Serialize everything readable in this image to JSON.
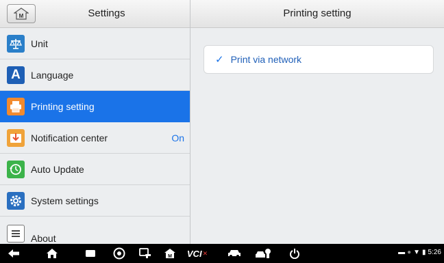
{
  "left_header": {
    "title": "Settings"
  },
  "right_header": {
    "title": "Printing setting"
  },
  "sidebar": {
    "items": [
      {
        "label": "Unit",
        "icon": "scale-icon",
        "value": ""
      },
      {
        "label": "Language",
        "icon": "language-icon",
        "value": ""
      },
      {
        "label": "Printing setting",
        "icon": "printer-icon",
        "value": "",
        "active": true
      },
      {
        "label": "Notification center",
        "icon": "notification-icon",
        "value": "On"
      },
      {
        "label": "Auto Update",
        "icon": "update-icon",
        "value": ""
      },
      {
        "label": "System settings",
        "icon": "gear-icon",
        "value": ""
      },
      {
        "label": "About",
        "icon": "about-icon",
        "value": ""
      }
    ]
  },
  "content": {
    "option_label": "Print via network",
    "option_checked": true
  },
  "navbar": {
    "vci_label": "VCI",
    "time": "5:26"
  },
  "colors": {
    "accent": "#1a73e8",
    "navbar": "#000000",
    "background": "#eceef0"
  }
}
